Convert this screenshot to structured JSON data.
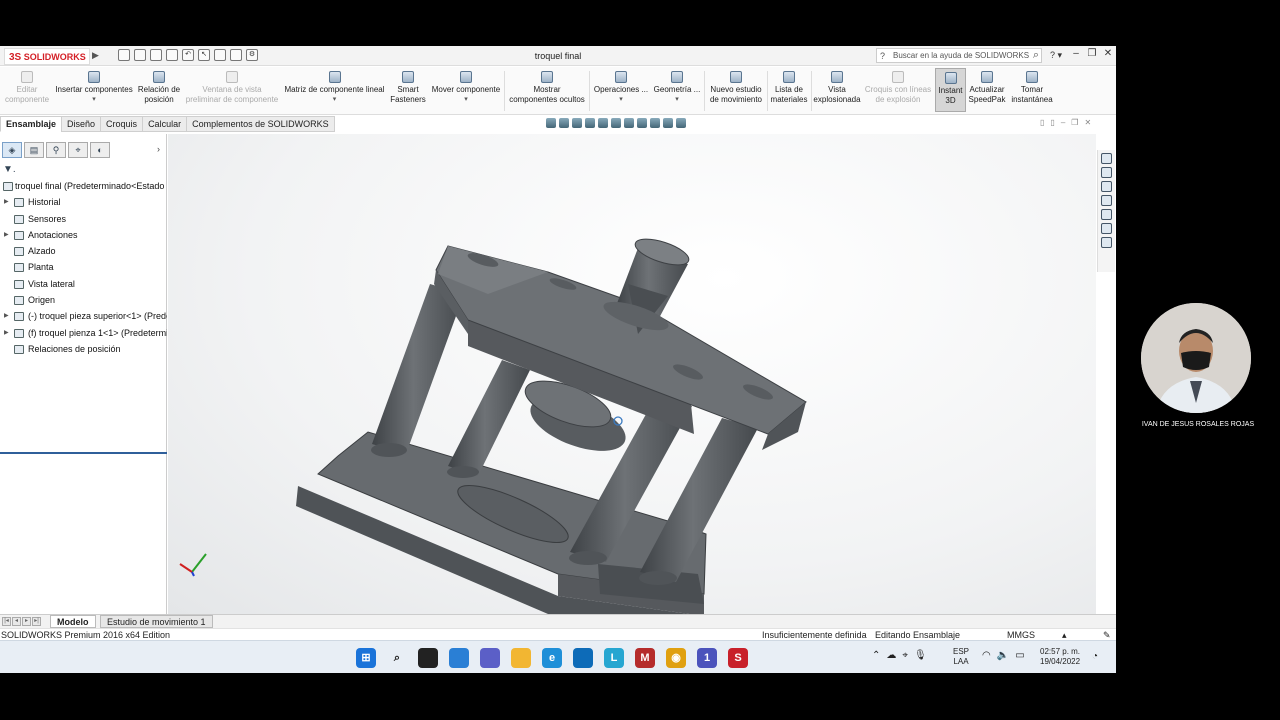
{
  "app": {
    "logo_text": "SOLIDWORKS",
    "title": "troquel final",
    "search_placeholder": "Buscar en la ayuda de SOLIDWORKS"
  },
  "commands": [
    {
      "label": "Editar\ncomponente",
      "disabled": true
    },
    {
      "label": "Insertar componentes",
      "disabled": false
    },
    {
      "label": "Relación de\nposición",
      "disabled": false
    },
    {
      "label": "Ventana de vista\npreliminar de componente",
      "disabled": true
    },
    {
      "label": "Matriz de componente lineal",
      "disabled": false
    },
    {
      "label": "Smart\nFasteners",
      "disabled": false
    },
    {
      "label": "Mover componente",
      "disabled": false
    },
    {
      "label": "Mostrar\ncomponentes ocultos",
      "disabled": false
    },
    {
      "label": "Operaciones ...",
      "disabled": false
    },
    {
      "label": "Geometría ...",
      "disabled": false
    },
    {
      "label": "Nuevo estudio\nde movimiento",
      "disabled": false
    },
    {
      "label": "Lista de\nmateriales",
      "disabled": false
    },
    {
      "label": "Vista\nexplosionada",
      "disabled": false
    },
    {
      "label": "Croquis con líneas\nde explosión",
      "disabled": true
    },
    {
      "label": "Instant\n3D",
      "disabled": false,
      "active": true
    },
    {
      "label": "Actualizar\nSpeedPak",
      "disabled": false
    },
    {
      "label": "Tomar\ninstantánea",
      "disabled": false
    }
  ],
  "tabs": [
    "Ensamblaje",
    "Diseño",
    "Croquis",
    "Calcular",
    "Complementos de SOLIDWORKS"
  ],
  "feature_tree": {
    "root": "troquel final  (Predeterminado<Estado",
    "items": [
      {
        "label": "Historial",
        "expand": true,
        "icon": "history-icon"
      },
      {
        "label": "Sensores",
        "expand": false,
        "icon": "sensor-icon"
      },
      {
        "label": "Anotaciones",
        "expand": true,
        "icon": "annotation-icon"
      },
      {
        "label": "Alzado",
        "expand": false,
        "icon": "plane-icon"
      },
      {
        "label": "Planta",
        "expand": false,
        "icon": "plane-icon"
      },
      {
        "label": "Vista lateral",
        "expand": false,
        "icon": "plane-icon"
      },
      {
        "label": "Origen",
        "expand": false,
        "icon": "origin-icon"
      },
      {
        "label": "(-) troquel pieza superior<1> (Prede",
        "expand": true,
        "icon": "part-icon"
      },
      {
        "label": "(f) troquel pienza 1<1> (Predetermi",
        "expand": true,
        "icon": "part-icon"
      },
      {
        "label": "Relaciones de posición",
        "expand": false,
        "icon": "mates-icon"
      }
    ]
  },
  "bottom_tabs": [
    "Modelo",
    "Estudio de movimiento 1"
  ],
  "status": {
    "edition": "SOLIDWORKS Premium 2016 x64 Edition",
    "definition": "Insuficientemente definida",
    "mode": "Editando Ensamblaje",
    "units": "MMGS"
  },
  "taskbar": {
    "lang_top": "ESP",
    "lang_bottom": "LAA",
    "time": "02:57 p. m.",
    "date": "19/04/2022",
    "teams_badge": "1"
  },
  "presenter_name": "IVAN DE JESUS ROSALES ROJAS",
  "colors": {
    "part": "#62666a",
    "accent": "#d41f26"
  }
}
